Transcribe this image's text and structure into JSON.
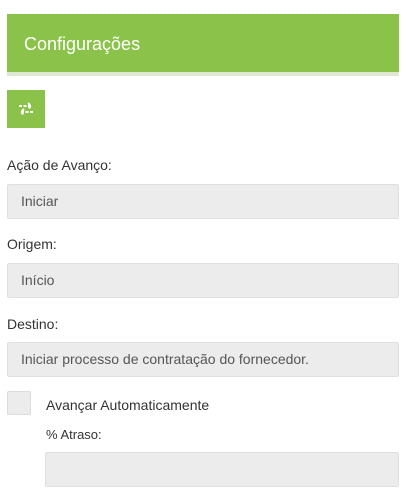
{
  "header": {
    "title": "Configurações"
  },
  "toolbar": {
    "swap_icon": "swap-arrows-icon"
  },
  "form": {
    "acao_label": "Ação de Avanço:",
    "acao_value": "Iniciar",
    "origem_label": "Origem:",
    "origem_value": "Início",
    "destino_label": "Destino:",
    "destino_value": "Iniciar processo de contratação do fornecedor.",
    "auto_label": "Avançar Automaticamente",
    "auto_checked": false,
    "atraso_label": "% Atraso:",
    "atraso_value": ""
  },
  "colors": {
    "accent": "#8bc34a",
    "field_bg": "#ececec"
  }
}
